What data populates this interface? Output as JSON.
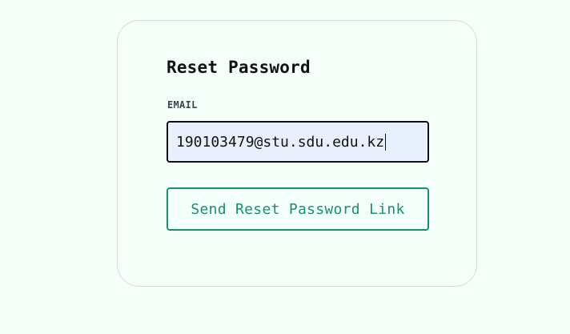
{
  "reset_form": {
    "title": "Reset Password",
    "email_label": "EMAIL",
    "email_value": "190103479@stu.sdu.edu.kz",
    "submit_label": "Send Reset Password Link"
  },
  "colors": {
    "background": "#f4fff9",
    "input_fill": "#e8f0fe",
    "accent": "#14936a",
    "border": "#d6ddd9"
  }
}
